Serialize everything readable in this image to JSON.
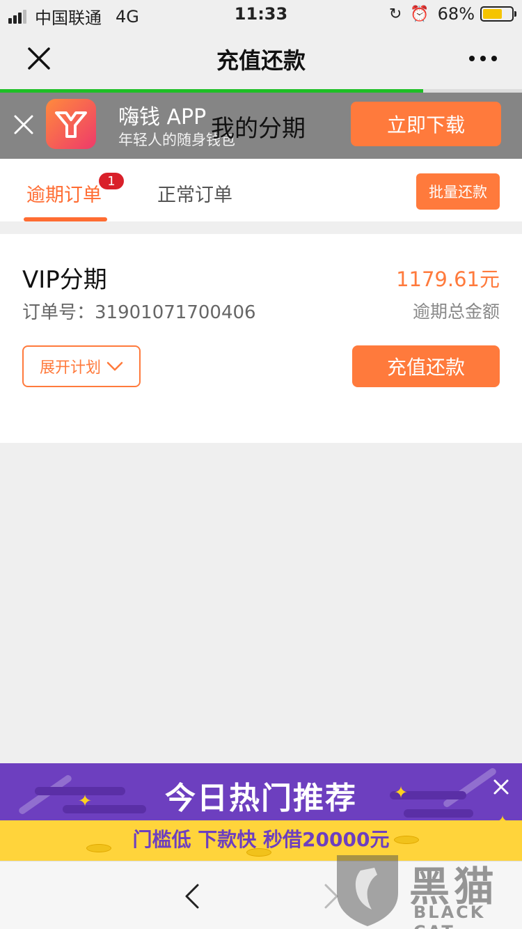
{
  "status_bar": {
    "carrier": "中国联通",
    "network": "4G",
    "time": "11:33",
    "battery_text": "68%",
    "battery_level": 0.68,
    "battery_color": "#f5c400"
  },
  "nav": {
    "title": "充值还款",
    "close_icon": "close-icon",
    "more_icon": "more-icon"
  },
  "page_load_progress": 0.81,
  "banner": {
    "app_name": "嗨钱 APP",
    "app_slogan": "年轻人的随身钱包",
    "page_heading": "我的分期",
    "download_label": "立即下载"
  },
  "tabs": {
    "overdue_label": "逾期订单",
    "overdue_badge": "1",
    "normal_label": "正常订单",
    "batch_label": "批量还款"
  },
  "order": {
    "title": "VIP分期",
    "amount": "1179.61元",
    "order_no_label": "订单号：",
    "order_no": "31901071700406",
    "amount_caption": "逾期总金额",
    "expand_label": "展开计划",
    "repay_label": "充值还款"
  },
  "promo": {
    "title": "今日热门推荐",
    "subtitle": "门槛低 下款快 秒借20000元"
  },
  "watermark": {
    "cn": "黑猫",
    "en": "BLACK CAT"
  },
  "colors": {
    "accent": "#ff7a3c",
    "badge": "#d9202a",
    "progress": "#1dbf25",
    "promo_bg": "#6d3fbf",
    "promo_strip": "#ffd43b"
  }
}
